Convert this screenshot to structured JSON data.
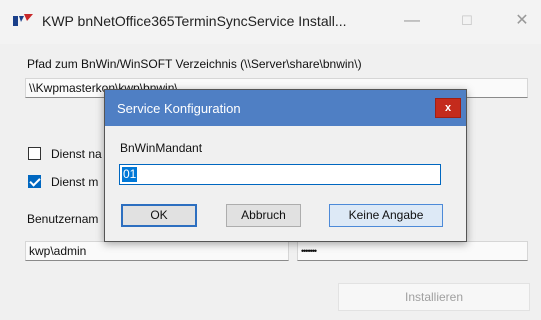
{
  "window": {
    "title": "KWP bnNetOffice365TerminSyncService Install...",
    "controls": {
      "minimize": "—",
      "maximize": "☐",
      "close": "✕"
    }
  },
  "main": {
    "path_label": "Pfad zum BnWin/WinSOFT Verzeichnis (\\\\Server\\share\\bnwin\\)",
    "path_value": "\\\\Kwpmasterkon\\kwp\\bnwin\\",
    "checkbox1": {
      "label": "Dienst na",
      "checked": false
    },
    "checkbox2": {
      "label": "Dienst m",
      "checked": true
    },
    "user_label": "Benutzernam",
    "user_value": "kwp\\admin",
    "password_value": "•••••••",
    "install_button": "Installieren"
  },
  "dialog": {
    "title": "Service Konfiguration",
    "close_label": "x",
    "field_label": "BnWinMandant",
    "field_value": "01",
    "ok_button": "OK",
    "cancel_button": "Abbruch",
    "none_button": "Keine Angabe"
  },
  "colors": {
    "dialog_titlebar": "#4f7fc4",
    "close_red": "#c42b1c",
    "accent_blue": "#0067c0"
  }
}
